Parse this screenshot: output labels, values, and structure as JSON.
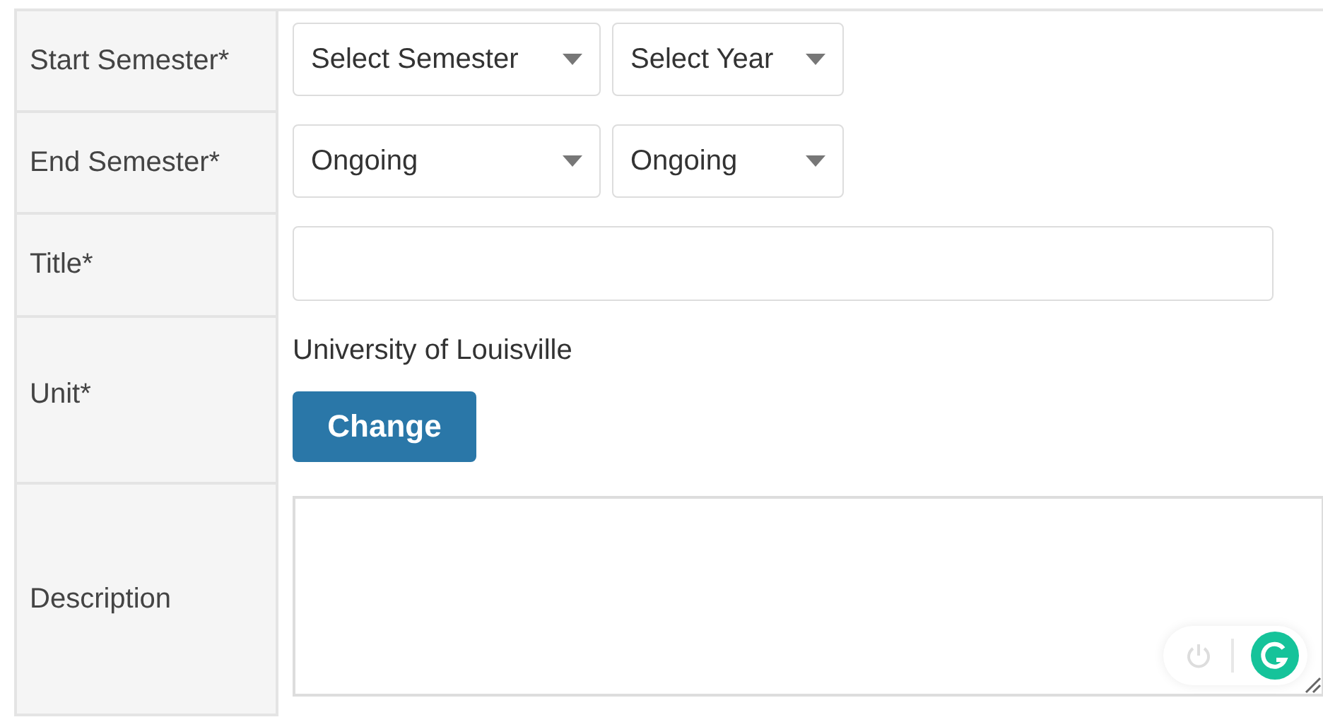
{
  "rows": [
    {
      "kind": "selects",
      "label": "Start Semester*",
      "selects": [
        {
          "value": "Select Semester"
        },
        {
          "value": "Select Year"
        }
      ]
    },
    {
      "kind": "selects",
      "label": "End Semester*",
      "selects": [
        {
          "value": "Ongoing"
        },
        {
          "value": "Ongoing"
        }
      ]
    },
    {
      "kind": "text",
      "label": "Title*"
    },
    {
      "kind": "unit",
      "label": "Unit*",
      "value": "University of Louisville",
      "button": "Change"
    },
    {
      "kind": "textarea",
      "label": "Description"
    }
  ]
}
